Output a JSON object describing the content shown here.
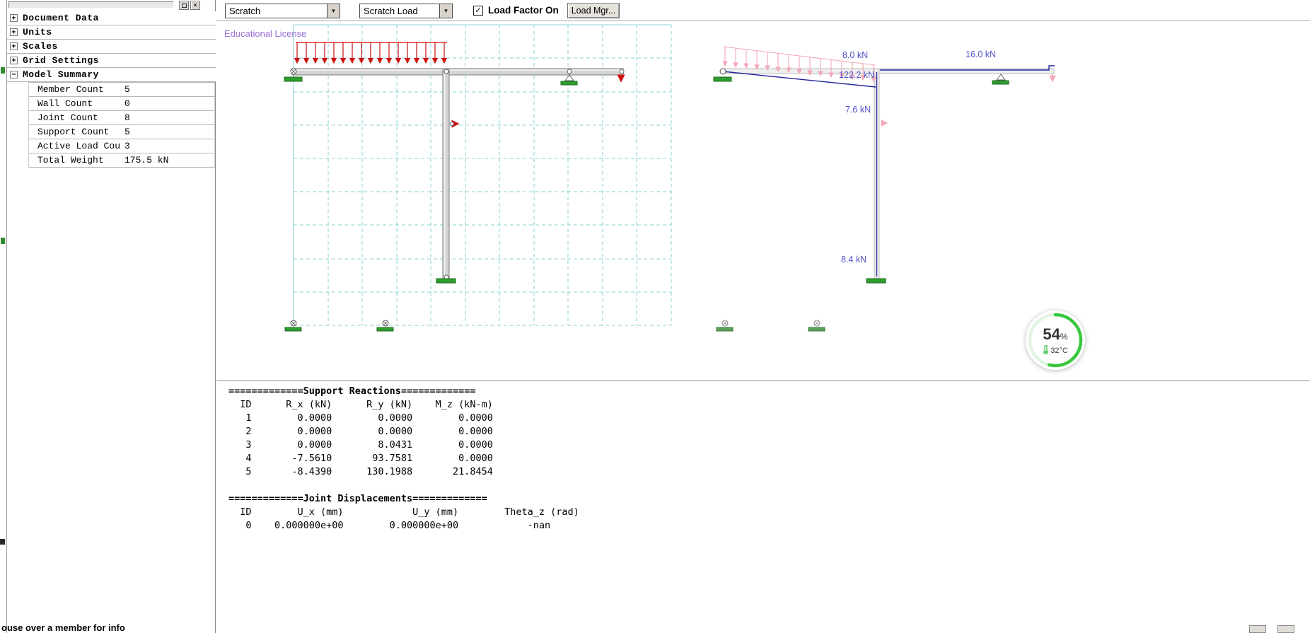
{
  "window": {
    "statusbar_hint": "ouse over a member for info"
  },
  "sidebar": {
    "close_glyph": "×",
    "tree": [
      {
        "glyph": "+",
        "label": "Document Data"
      },
      {
        "glyph": "+",
        "label": "Units"
      },
      {
        "glyph": "+",
        "label": "Scales"
      },
      {
        "glyph": "+",
        "label": "Grid Settings"
      },
      {
        "glyph": "−",
        "label": "Model Summary"
      }
    ],
    "summary": [
      {
        "label": "Member Count",
        "value": "5"
      },
      {
        "label": "Wall Count",
        "value": "0"
      },
      {
        "label": "Joint Count",
        "value": "8"
      },
      {
        "label": "Support Count",
        "value": "5"
      },
      {
        "label": "Active Load Cou",
        "value": "3"
      },
      {
        "label": "Total Weight",
        "value": "175.5 kN"
      }
    ]
  },
  "toolbar": {
    "combo_arrow_glyph": "▼",
    "case_combo": {
      "value": "Scratch"
    },
    "load_combo": {
      "value": "Scratch Load"
    },
    "load_factor": {
      "label": "Load Factor On",
      "checked": true,
      "check_glyph": "✓"
    },
    "load_mgr_label": "Load Mgr..."
  },
  "canvas": {
    "license_text": "Educational License",
    "force_labels": [
      "8.0 kN",
      "122.2 kN",
      "16.0 kN",
      "7.6 kN",
      "8.4 kN"
    ],
    "badge": {
      "percent": "54",
      "percent_symbol": "%",
      "temperature": "32°C"
    },
    "accent_colors": {
      "load_red": "#cc1111",
      "result_blue": "#24249b",
      "grid_teal": "#8ad2d2",
      "support_green": "#2f9e2f",
      "badge_green": "#38c83e",
      "label_blue": "#5353cb"
    }
  },
  "output": {
    "support_header": "=============Support Reactions=============",
    "support_columns": "  ID      R_x (kN)      R_y (kN)    M_z (kN-m)",
    "support_rows": [
      "   1        0.0000        0.0000        0.0000",
      "   2        0.0000        0.0000        0.0000",
      "   3        0.0000        8.0431        0.0000",
      "   4       -7.5610       93.7581        0.0000",
      "   5       -8.4390      130.1988       21.8454"
    ],
    "joint_header": "=============Joint Displacements=============",
    "joint_columns": "  ID        U_x (mm)            U_y (mm)        Theta_z (rad)",
    "joint_rows": [
      "   0    0.000000e+00        0.000000e+00            -nan"
    ]
  }
}
